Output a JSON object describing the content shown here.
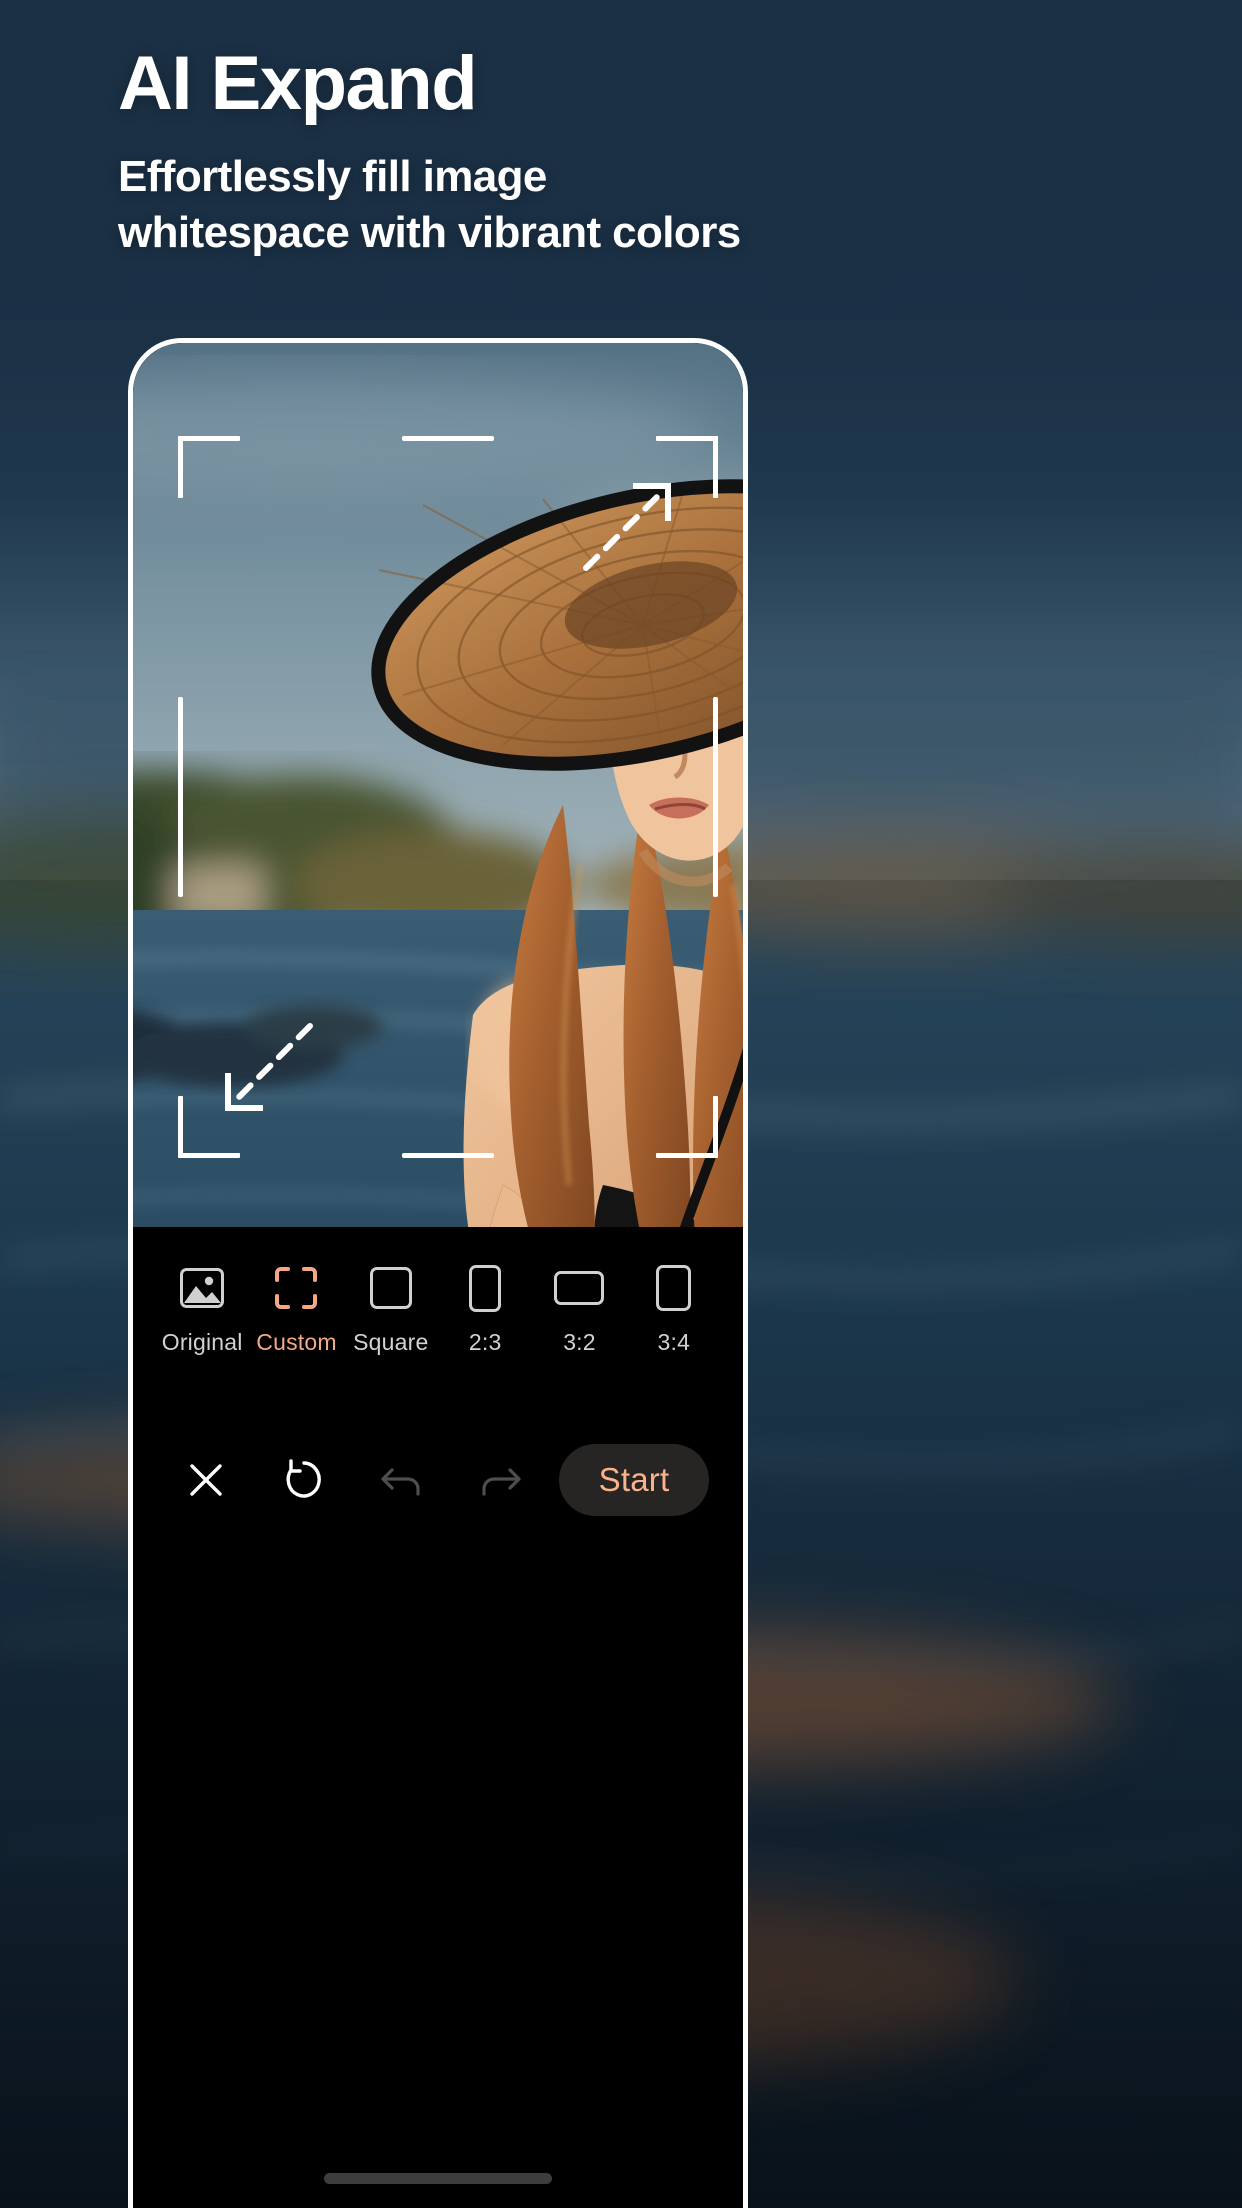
{
  "promo": {
    "headline": "AI Expand",
    "subhead_line1": "Effortlessly fill image",
    "subhead_line2": "whitespace with vibrant colors"
  },
  "colors": {
    "background_navy": "#1d3247",
    "accent_peach": "#f3a983",
    "start_text": "#fcb28b",
    "start_pill": "#262523",
    "panel_black": "#000000",
    "icon_grey": "#d0d0d0",
    "label_grey": "#d2d2d2"
  },
  "editor": {
    "ratio_options": [
      {
        "label": "Original",
        "icon": "image-icon",
        "active": false
      },
      {
        "label": "Custom",
        "icon": "crop-brackets-icon",
        "active": true
      },
      {
        "label": "Square",
        "icon": "square-icon",
        "active": false
      },
      {
        "label": "2:3",
        "icon": "portrait-2-3-icon",
        "active": false
      },
      {
        "label": "3:2",
        "icon": "landscape-3-2-icon",
        "active": false
      },
      {
        "label": "3:4",
        "icon": "portrait-3-4-icon",
        "active": false
      }
    ],
    "actions": [
      {
        "name": "close",
        "icon": "close-x-icon",
        "enabled": true
      },
      {
        "name": "reset",
        "icon": "rotate-ccw-icon",
        "enabled": true
      },
      {
        "name": "undo",
        "icon": "undo-arrow-icon",
        "enabled": false
      },
      {
        "name": "redo",
        "icon": "redo-arrow-icon",
        "enabled": false
      }
    ],
    "start_label": "Start"
  },
  "canvas": {
    "crop_frame": "custom-expand-crop-frame",
    "resize_hint_top_right": "diagonal-expand-arrow",
    "resize_hint_bottom_left": "diagonal-expand-arrow"
  },
  "photo": {
    "description": "woman in straw sun hat kneeling in lake at golden hour"
  }
}
